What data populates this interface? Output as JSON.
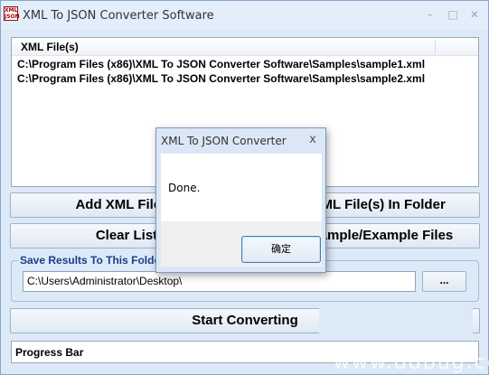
{
  "window": {
    "title": "XML To JSON Converter Software",
    "icon_text_top": "XML",
    "icon_text_bottom": "JSON",
    "minimize": "–",
    "maximize": "□",
    "close": "✕"
  },
  "file_list": {
    "header": "XML File(s)",
    "rows": [
      "C:\\Program Files (x86)\\XML To JSON Converter Software\\Samples\\sample1.xml",
      "C:\\Program Files (x86)\\XML To JSON Converter Software\\Samples\\sample2.xml"
    ]
  },
  "buttons": {
    "add_files": "Add XML File(s)",
    "add_folder": "Add XML File(s) In Folder",
    "clear_list": "Clear List",
    "load_samples": "Load Sample/Example Files",
    "browse": "...",
    "start": "Start Converting"
  },
  "save_group": {
    "label": "Save Results To This Folder",
    "path": "C:\\Users\\Administrator\\Desktop\\"
  },
  "progress": {
    "label": "Progress Bar"
  },
  "watermark": "www.ddbug.cc",
  "dialog": {
    "title": "XML To JSON Converter",
    "close": "x",
    "message": "Done.",
    "ok_label": "确定"
  },
  "colors": {
    "window_bg": "#dce9f7",
    "group_label": "#1c3f86",
    "dialog_button_border": "#3c7fb1"
  }
}
